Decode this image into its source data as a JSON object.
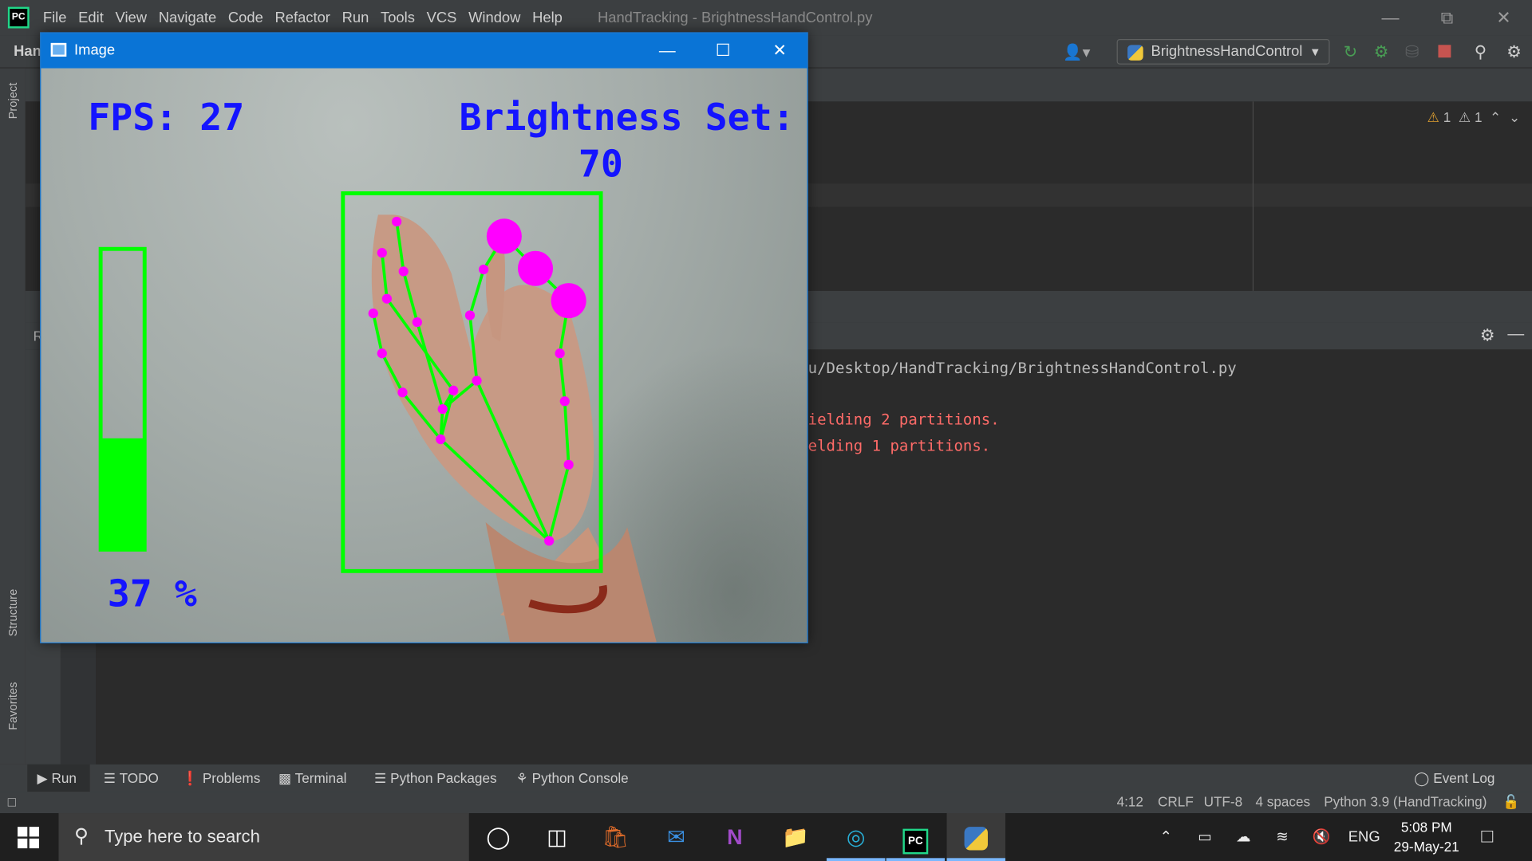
{
  "ide": {
    "menu": [
      "File",
      "Edit",
      "View",
      "Navigate",
      "Code",
      "Refactor",
      "Run",
      "Tools",
      "VCS",
      "Window",
      "Help"
    ],
    "window_title": "HandTracking - BrightnessHandControl.py",
    "project_crumb": "Han",
    "run_config": "BrightnessHandControl",
    "left_tabs": {
      "project": "Project",
      "structure": "Structure",
      "favorites": "Favorites"
    },
    "run_side_label": "R",
    "warnings": {
      "a": "1",
      "b": "1"
    },
    "console": {
      "path_line": "u/Desktop/HandTracking/BrightnessHandControl.py",
      "err1": "ielding 2 partitions.",
      "err2": "elding 1 partitions."
    },
    "tool_tabs": [
      "Run",
      "TODO",
      "Problems",
      "Terminal",
      "Python Packages",
      "Python Console"
    ],
    "event_log": "Event Log",
    "status": {
      "position": "4:12",
      "line_sep": "CRLF",
      "encoding": "UTF-8",
      "indent": "4 spaces",
      "interpreter": "Python 3.9 (HandTracking)"
    }
  },
  "image_window": {
    "title": "Image",
    "fps_label": "FPS: 27",
    "brightness_label": "Brightness Set:",
    "brightness_value": "70",
    "percent_label": "37 %",
    "bar_fill_fraction": 0.37,
    "colors": {
      "text": "#1414ff",
      "bar": "#00ff00",
      "landmark": "#ff00ff",
      "box": "#00ff00"
    }
  },
  "taskbar": {
    "search_placeholder": "Type here to search",
    "language": "ENG",
    "time": "5:08 PM",
    "date": "29-May-21"
  }
}
